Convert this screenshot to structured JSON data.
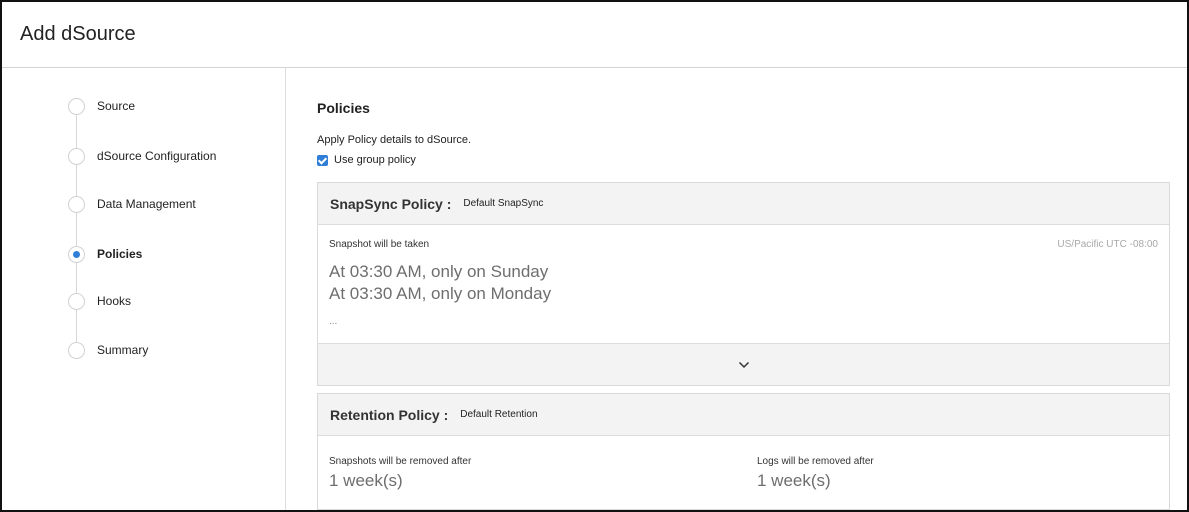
{
  "header": {
    "title": "Add dSource"
  },
  "steps": [
    {
      "label": "Source",
      "active": false
    },
    {
      "label": "dSource Configuration",
      "active": false
    },
    {
      "label": "Data Management",
      "active": false
    },
    {
      "label": "Policies",
      "active": true
    },
    {
      "label": "Hooks",
      "active": false
    },
    {
      "label": "Summary",
      "active": false
    }
  ],
  "policies": {
    "title": "Policies",
    "description": "Apply Policy details to dSource.",
    "use_group_policy": {
      "label": "Use group policy",
      "checked": true
    }
  },
  "snapsync": {
    "title": "SnapSync Policy :",
    "value": "Default SnapSync",
    "caption": "Snapshot will be taken",
    "timezone": "US/Pacific UTC -08:00",
    "schedule": [
      "At 03:30 AM, only on Sunday",
      "At 03:30 AM, only on Monday"
    ],
    "ellipsis": "...",
    "expand_icon": "chevron-down-icon"
  },
  "retention": {
    "title": "Retention Policy :",
    "value": "Default Retention",
    "snapshots_caption": "Snapshots will be removed after",
    "snapshots_value": "1 week(s)",
    "logs_caption": "Logs will be removed after",
    "logs_value": "1 week(s)"
  },
  "colors": {
    "accent": "#2f7fd8",
    "panel_header": "#f3f3f3",
    "border": "#d9d9d9"
  }
}
